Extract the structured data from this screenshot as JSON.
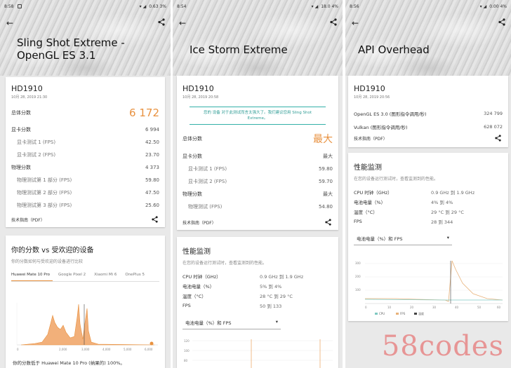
{
  "panels": [
    {
      "status": {
        "time": "8:58",
        "icons": "  ",
        "right": "0.63  3%"
      },
      "title": "Sling Shot Extreme - OpenGL ES 3.1",
      "device": "HD1910",
      "date": "10月 28, 2019 21:30",
      "score_label": "总体分数",
      "score": "6 172",
      "rows": [
        {
          "label": "显卡分数",
          "value": "6 994",
          "sub": false
        },
        {
          "label": "显卡测试 1 (FPS)",
          "value": "42.50",
          "sub": true
        },
        {
          "label": "显卡测试 2 (FPS)",
          "value": "23.70",
          "sub": true
        },
        {
          "label": "物理分数",
          "value": "4 373",
          "sub": false
        },
        {
          "label": "物理测试第 1 部分 (FPS)",
          "value": "59.80",
          "sub": true
        },
        {
          "label": "物理测试第 2 部分 (FPS)",
          "value": "47.50",
          "sub": true
        },
        {
          "label": "物理测试第 3 部分 (FPS)",
          "value": "25.60",
          "sub": true
        }
      ],
      "footer": "技术指南（PDF）",
      "compare_title": "你的分数 vs 受欢迎的设备",
      "compare_sub": "你的分数如何与受欢迎的设备进行比较",
      "tabs": [
        "Huawei Mate 10 Pro",
        "Google Pixel 2",
        "Xiaomi Mi 6",
        "OnePlus 5"
      ],
      "hist_ticks": [
        "0",
        "2,000",
        "3,000",
        "4,000",
        "5,000",
        "6,000"
      ],
      "hist_note": "你的分数低于 Huawei Mate 10 Pro (纳果的) 100%。"
    },
    {
      "status": {
        "time": "8:54",
        "icons": "",
        "right": "18.0  4%"
      },
      "title": "Ice Storm Extreme",
      "device": "HD1910",
      "date": "10月 28, 2019 20:58",
      "banner": "您的 设备 对于此测试而言太强大了。我们建议您用 Sling Shot Extreme。",
      "score_label": "总体分数",
      "score": "最大",
      "rows": [
        {
          "label": "显卡分数",
          "value": "最大",
          "sub": false
        },
        {
          "label": "显卡测试 1 (FPS)",
          "value": "59.80",
          "sub": true
        },
        {
          "label": "显卡测试 2 (FPS)",
          "value": "59.70",
          "sub": true
        },
        {
          "label": "物理分数",
          "value": "最大",
          "sub": false
        },
        {
          "label": "物理测试 (FPS)",
          "value": "54.80",
          "sub": true
        }
      ],
      "footer": "技术指南（PDF）",
      "monitor_title": "性能监测",
      "monitor": [
        {
          "k": "CPU 时钟（GHz）",
          "v": "0.9 GHz 到 1.9 GHz"
        },
        {
          "k": "电池电量（%）",
          "v": "5% 到 4%"
        },
        {
          "k": "温度（°C）",
          "v": "28 °C 到 29 °C"
        },
        {
          "k": "FPS",
          "v": "50 到 133"
        }
      ],
      "select": "电池电量（%）和 FPS",
      "chart_ticks": [
        "120",
        "100",
        "80"
      ]
    },
    {
      "status": {
        "time": "8:56",
        "icons": "",
        "right": "0.00  4%"
      },
      "title": "API Overhead",
      "device": "HD1910",
      "date": "10月 28, 2019 20:56",
      "rows": [
        {
          "label": "OpenGL ES 3.0 (图形指令调用/秒)",
          "value": "324 799",
          "sub": false
        },
        {
          "label": "Vulkan (图形指令调用/秒)",
          "value": "628 072",
          "sub": false
        }
      ],
      "footer": "技术指南（PDF）",
      "monitor_title": "性能监测",
      "monitor_sub": "在您的设备运行测试时，查看监测到的性能。",
      "monitor": [
        {
          "k": "CPU 时钟（GHz）",
          "v": "0.9 GHz 到 1.9 GHz"
        },
        {
          "k": "电池电量（%）",
          "v": "4% 到 4%"
        },
        {
          "k": "温度（°C）",
          "v": "29 °C 到 29 °C"
        },
        {
          "k": "FPS",
          "v": "28 到 344"
        }
      ],
      "select": "电池电量（%）和 FPS",
      "chart_y": [
        "300",
        "200",
        "100"
      ],
      "chart_x": [
        "0",
        "10",
        "20",
        "30",
        "40",
        "50",
        "60"
      ],
      "legend": [
        "CPU",
        "FPS",
        "温度"
      ]
    }
  ],
  "monitor_sub2": "在您的设备运行测试时，查看监测到的性能。",
  "watermark": "58codes",
  "colors": {
    "accent": "#e8913f",
    "teal": "#33b0a8"
  }
}
